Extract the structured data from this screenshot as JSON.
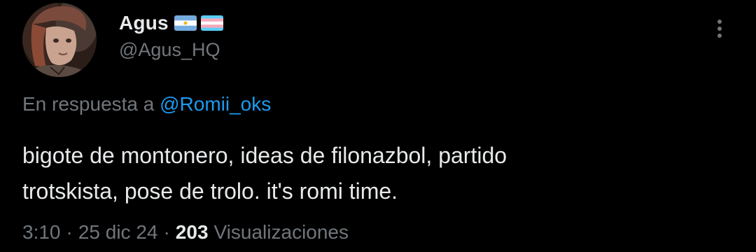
{
  "author": {
    "display_name": "Agus",
    "handle": "@Agus_HQ",
    "flags": [
      "argentina-flag-icon",
      "transgender-flag-icon"
    ],
    "avatar_icon": "avatar"
  },
  "reply": {
    "prefix": "En respuesta a",
    "mention": "@Romii_oks"
  },
  "tweet": {
    "text": "bigote de montonero, ideas de filonazbol, partido\ntrotskista, pose de trolo. it's romi time."
  },
  "meta": {
    "time": "3:10",
    "separator": "·",
    "date": "25 dic 24",
    "views_count": "203",
    "views_label": "Visualizaciones"
  },
  "colors": {
    "background": "#000000",
    "text_primary": "#e7e9ea",
    "text_secondary": "#71767b",
    "link": "#1d9bf0"
  }
}
